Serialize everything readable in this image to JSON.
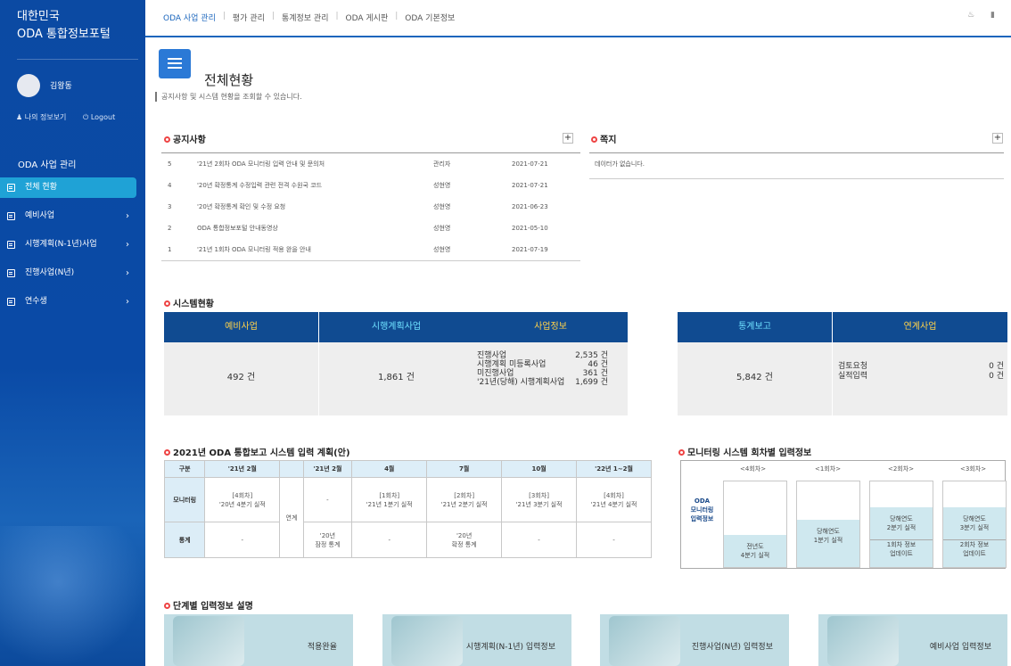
{
  "sidebar": {
    "brand_line1": "대한민국",
    "brand_line2": "ODA 통합정보포털",
    "user_name": "김왕동",
    "my_info": "나의 정보보기",
    "logout": "Logout",
    "section_title": "ODA 사업 관리",
    "items": [
      {
        "label": "전체 현황",
        "active": true,
        "chevron": ""
      },
      {
        "label": "예비사업",
        "active": false,
        "chevron": "›"
      },
      {
        "label": "시행계획(N-1년)사업",
        "active": false,
        "chevron": "›"
      },
      {
        "label": "진행사업(N년)",
        "active": false,
        "chevron": "›"
      },
      {
        "label": "연수생",
        "active": false,
        "chevron": "›"
      }
    ]
  },
  "topnav": {
    "items": [
      "ODA 사업 관리",
      "평가 관리",
      "통계정보 관리",
      "ODA 게시판",
      "ODA 기본정보"
    ],
    "icons": [
      "bell-icon",
      "chat-icon"
    ]
  },
  "page": {
    "title": "전체현황",
    "subtitle": "공지사항 및 시스템 현황을 조회할 수 있습니다."
  },
  "notice": {
    "title": "공지사항",
    "plus": "+",
    "rows": [
      {
        "num": "5",
        "title": "'21년 2회차 ODA 모니터링 입력 안내 및 문의처",
        "writer": "관리자",
        "date": "2021-07-21"
      },
      {
        "num": "4",
        "title": "'20년 확정통계 수정입력 관련 전격 수원국 코드",
        "writer": "성현영",
        "date": "2021-07-21"
      },
      {
        "num": "3",
        "title": "'20년 확정통계 확인 및 수정 요청",
        "writer": "성현영",
        "date": "2021-06-23"
      },
      {
        "num": "2",
        "title": "ODA 통합정보포털 안내동영상",
        "writer": "성현영",
        "date": "2021-05-10"
      },
      {
        "num": "1",
        "title": "'21년 1회차 ODA 모니터링 적용 완을 안내",
        "writer": "성현영",
        "date": "2021-07-19"
      }
    ]
  },
  "messages": {
    "title": "쪽지",
    "plus": "+",
    "empty": "데이터가 없습니다."
  },
  "system": {
    "title": "시스템현황",
    "cards": [
      {
        "label": "예비사업",
        "value": "492 건"
      },
      {
        "label": "시행계획사업",
        "value": "1,861 건"
      },
      {
        "label": "사업정보",
        "rows": [
          {
            "k": "진행사업",
            "v": "2,535 건"
          },
          {
            "k": "시행계획 미등록사업",
            "v": "46 건"
          },
          {
            "k": "미진행사업",
            "v": "361 건"
          },
          {
            "k": "'21년(당해) 시행계획사업",
            "v": "1,699 건"
          }
        ]
      },
      {
        "label": "통계보고",
        "value": "5,842 건"
      },
      {
        "label": "연계사업",
        "rows": [
          {
            "k": "검토요청",
            "v": "0 건"
          },
          {
            "k": "실적입력",
            "v": "0 건"
          }
        ]
      }
    ]
  },
  "plan": {
    "title": "2021년 ODA 통합보고 시스템 입력 계획(안)",
    "headers": [
      "구분",
      "'21년 2월",
      "",
      "'21년 2월",
      "4월",
      "7월",
      "10월",
      "'22년 1~2월"
    ],
    "row1_label": "모니터링",
    "row1": [
      "[4회차]\n'20년 4분기 실적",
      "-",
      "[1회차]\n'21년 1분기 실적",
      "[2회차]\n'21년 2분기 실적",
      "[3회차]\n'21년 3분기 실적",
      "[4회차]\n'21년 4분기 실적"
    ],
    "link_cell": "연계",
    "row2_label": "통계",
    "row2": [
      "-",
      "'20년\n잠정 통계",
      "-",
      "'20년\n확정 통계",
      "-",
      "-"
    ]
  },
  "monitor": {
    "title": "모니터링 시스템 회차별 입력정보",
    "label": "ODA\n모니터링\n입력정보",
    "cols": [
      {
        "head": "<4회차>",
        "level": 0.37,
        "text": "전년도\n4분기 실적",
        "next": ""
      },
      {
        "head": "<1회차>",
        "level": 0.55,
        "text": "당해연도\n1분기 실적",
        "next": ""
      },
      {
        "head": "<2회차>",
        "level": 0.7,
        "text": "당해연도\n2분기 실적",
        "next": "1회차 정보\n업데이트"
      },
      {
        "head": "<3회차>",
        "level": 0.7,
        "text": "당해연도\n3분기 실적",
        "next": "2회차 정보\n업데이트"
      }
    ]
  },
  "steps": {
    "title": "단계별 입력정보 설명",
    "banners": [
      "적용완율",
      "시행계획(N-1년) 입력정보",
      "진행사업(N년) 입력정보",
      "예비사업 입력정보"
    ]
  }
}
